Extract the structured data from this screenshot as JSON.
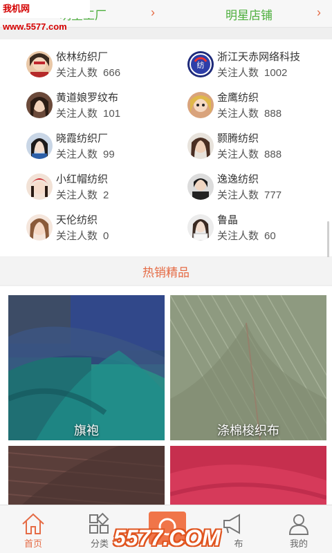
{
  "watermark": "我机网 www.5577.com",
  "tabs": [
    {
      "label": "明星工厂"
    },
    {
      "label": "明星店铺"
    }
  ],
  "follow_label": "关注人数",
  "stores": [
    {
      "name": "依林纺织厂",
      "followers": "666"
    },
    {
      "name": "浙江天赤网络科技",
      "followers": "1002"
    },
    {
      "name": "黄道娘罗纹布",
      "followers": "101"
    },
    {
      "name": "金鹰纺织",
      "followers": "888"
    },
    {
      "name": "晓霞纺织厂",
      "followers": "99"
    },
    {
      "name": "颢腾纺织",
      "followers": "888"
    },
    {
      "name": "小红帽纺织",
      "followers": "2"
    },
    {
      "name": "逸逸纺织",
      "followers": "777"
    },
    {
      "name": "天伦纺织",
      "followers": "0"
    },
    {
      "name": "鲁晶",
      "followers": "60"
    }
  ],
  "hot_title": "热销精品",
  "products": [
    {
      "label": "旗袍"
    },
    {
      "label": "涤棉梭织布"
    },
    {
      "label": ""
    },
    {
      "label": ""
    }
  ],
  "nav": [
    {
      "label": "首页",
      "icon": "home-icon"
    },
    {
      "label": "分类",
      "icon": "category-icon"
    },
    {
      "label": "",
      "icon": "search-icon"
    },
    {
      "label": "布",
      "icon": "megaphone-icon"
    },
    {
      "label": "我的",
      "icon": "user-icon"
    }
  ],
  "brand_text": "5577.COM",
  "colors": {
    "accent": "#e56b45",
    "green": "#4cae3c"
  }
}
